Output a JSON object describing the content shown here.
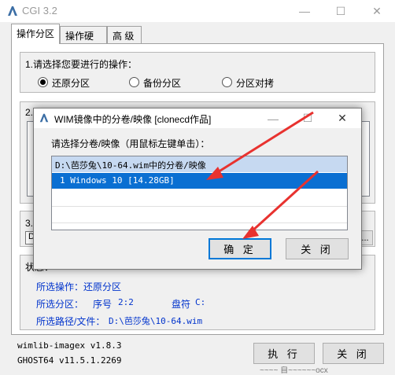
{
  "window": {
    "title": "CGI 3.2",
    "minimize": "—",
    "maximize": "☐",
    "close": "✕"
  },
  "tabs": [
    "操作分区",
    "操作硬盘",
    "高 级"
  ],
  "section1": {
    "label": "1.请选择您要进行的操作：",
    "options": [
      {
        "label": "还原分区",
        "selected": true
      },
      {
        "label": "备份分区",
        "selected": false
      },
      {
        "label": "分区对拷",
        "selected": false
      }
    ]
  },
  "section2": {
    "label_fragment": "2."
  },
  "section3": {
    "label": "3.",
    "row_prefix": "D",
    "browse_label": "..."
  },
  "status": {
    "title": "状态：",
    "operation_label": "所选操作：",
    "operation_value": "还原分区",
    "partition_label": "所选分区：",
    "seq_label": "序号",
    "seq_value": "2:2",
    "drive_label": "盘符",
    "drive_value": "C:",
    "path_label": "所选路径/文件：",
    "path_value": "D:\\芭莎兔\\10-64.wim"
  },
  "footer": {
    "version1": "wimlib-imagex v1.8.3",
    "version2": "GHOST64 v11.5.1.2269",
    "run_label": "执 行",
    "close_label": "关 闭",
    "behind_text": "~~~~ 自~~~~~~ocx"
  },
  "dialog": {
    "title": "WIM镜像中的分卷/映像  [clonecd作品]",
    "prompt": "请选择分卷/映像（用鼠标左键单击）：",
    "list_header": "D:\\芭莎兔\\10-64.wim中的分卷/映像",
    "items": [
      {
        "label": "1  Windows 10  [14.28GB]",
        "selected": true
      }
    ],
    "ok_label": "确 定",
    "cancel_label": "关 闭"
  },
  "colors": {
    "accent": "#0078d7",
    "selection": "#0a6fd2",
    "list_header": "#c6d9f1",
    "status_text": "#0033cc",
    "annotation_arrow": "#e8322f"
  }
}
